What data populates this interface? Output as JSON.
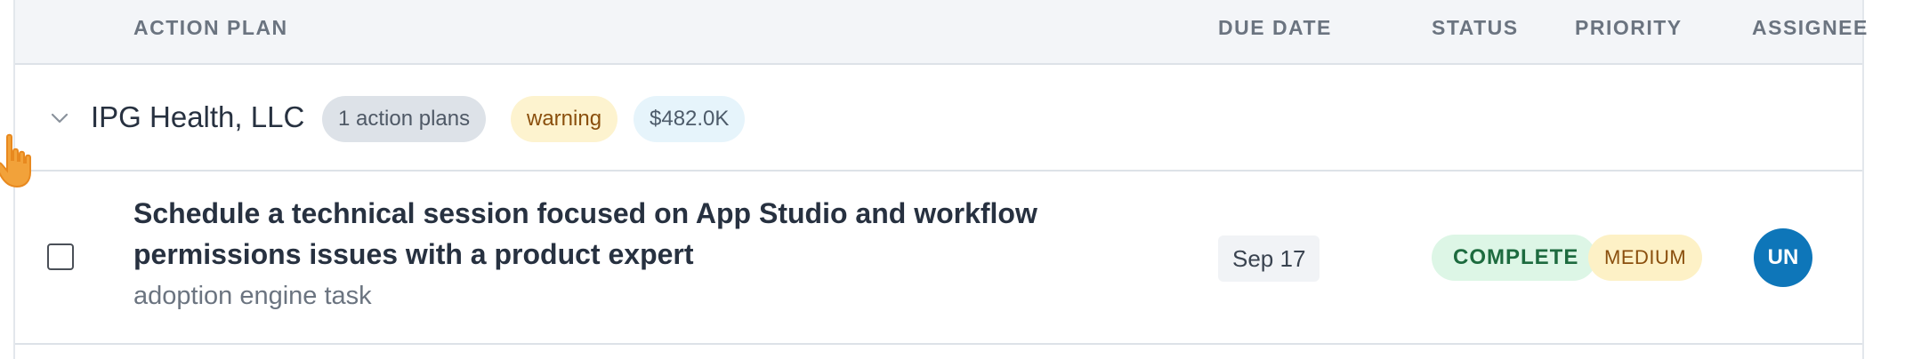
{
  "header": {
    "action_plan": "ACTION PLAN",
    "due_date": "DUE DATE",
    "status": "STATUS",
    "priority": "PRIORITY",
    "assignee": "ASSIGNEE"
  },
  "group": {
    "name": "IPG Health, LLC",
    "plans_badge": "1 action plans",
    "health_badge": "warning",
    "amount_badge": "$482.0K"
  },
  "task": {
    "title": "Schedule a technical session focused on App Studio and workflow permissions issues with a product expert",
    "subtitle": "adoption engine task",
    "due": "Sep 17",
    "status": "COMPLETE",
    "priority": "MEDIUM",
    "assignee_initials": "UN",
    "checked": false
  },
  "icons": {
    "expand": "chevron-down-icon",
    "pointer": "hand-pointer-icon"
  },
  "colors": {
    "assignee_avatar": "#0e76b9",
    "status_complete_bg": "#ddf6e6",
    "status_complete_text": "#1d6b3f",
    "priority_medium_bg": "#fdf1c6",
    "warning_bg": "#fdf3cf",
    "cursor": "#e8891f"
  }
}
